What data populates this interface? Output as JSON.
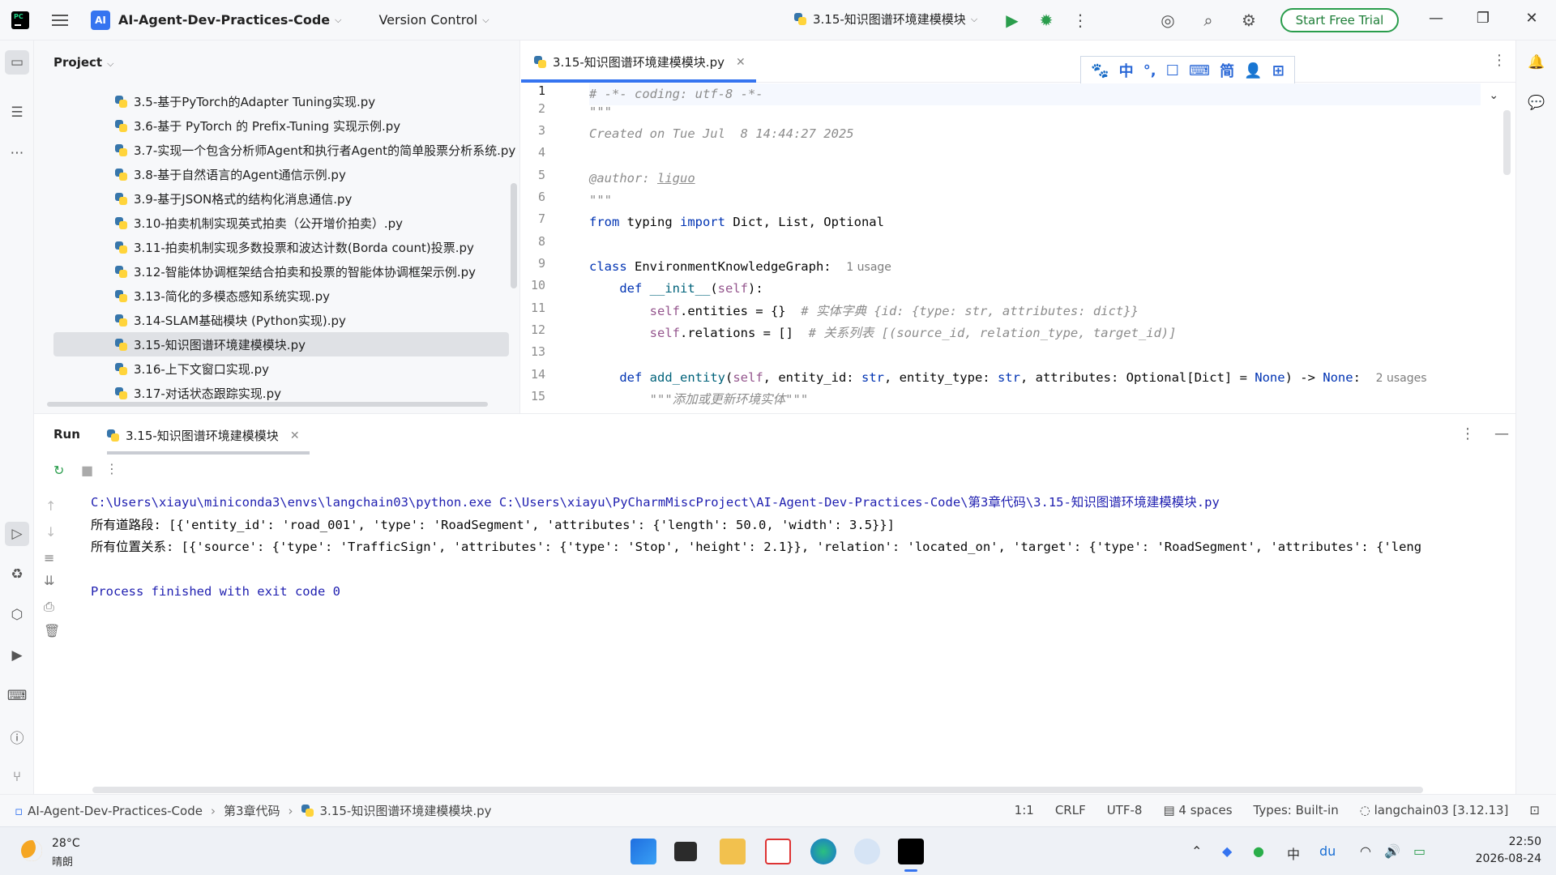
{
  "titlebar": {
    "project_badge": "AI",
    "project_name": "AI-Agent-Dev-Practices-Code",
    "version_control": "Version Control",
    "run_config": "3.15-知识图谱环境建模模块",
    "trial_button": "Start Free Trial"
  },
  "project_panel": {
    "title": "Project",
    "files": [
      "3.5-基于PyTorch的Adapter Tuning实现.py",
      "3.6-基于 PyTorch 的 Prefix-Tuning 实现示例.py",
      "3.7-实现一个包含分析师Agent和执行者Agent的简单股票分析系统.py",
      "3.8-基于自然语言的Agent通信示例.py",
      "3.9-基于JSON格式的结构化消息通信.py",
      "3.10-拍卖机制实现英式拍卖（公开增价拍卖）.py",
      "3.11-拍卖机制实现多数投票和波达计数(Borda count)投票.py",
      "3.12-智能体协调框架结合拍卖和投票的智能体协调框架示例.py",
      "3.13-简化的多模态感知系统实现.py",
      "3.14-SLAM基础模块 (Python实现).py",
      "3.15-知识图谱环境建模模块.py",
      "3.16-上下文窗口实现.py",
      "3.17-对话状态跟踪实现.py"
    ]
  },
  "editor": {
    "tab_label": "3.15-知识图谱环境建模模块.py",
    "inspection_count": "1",
    "ime_buttons": [
      "🐾",
      "中",
      "°,",
      "☐",
      "⌨",
      "简",
      "👤",
      "⊞"
    ],
    "line_numbers": [
      "1",
      "2",
      "3",
      "4",
      "5",
      "6",
      "7",
      "8",
      "9",
      "10",
      "11",
      "12",
      "13",
      "14",
      "15"
    ],
    "lines": {
      "l1": "# -*- coding: utf-8 -*-",
      "l2": "\"\"\"",
      "l3": "Created on Tue Jul  8 14:44:27 2025",
      "l5_a": "@author: ",
      "l5_b": "liguo",
      "l6": "\"\"\"",
      "l7_from": "from",
      "l7_mid": " typing ",
      "l7_import": "import",
      "l7_rest": " Dict, List, Optional",
      "l9_class": "class",
      "l9_name": " EnvironmentKnowledgeGraph:",
      "l9_hint": "1 usage",
      "l10_def": "    def",
      "l10_fn": " __init__",
      "l10_p": "(",
      "l10_self": "self",
      "l10_end": "):",
      "l11_self": "        self",
      "l11_code": ".entities = {}  ",
      "l11_cmt": "# 实体字典 {id: {type: str, attributes: dict}}",
      "l12_self": "        self",
      "l12_code": ".relations = []  ",
      "l12_cmt": "# 关系列表 [(source_id, relation_type, target_id)]",
      "l14_def": "    def",
      "l14_fn": " add_entity",
      "l14_p": "(",
      "l14_self": "self",
      "l14_args1": ", entity_id: ",
      "l14_str1": "str",
      "l14_args2": ", entity_type: ",
      "l14_str2": "str",
      "l14_args3": ", attributes: Optional[Dict] = ",
      "l14_none": "None",
      "l14_arrow": ") -> ",
      "l14_none2": "None",
      "l14_colon": ":",
      "l14_hint": "2 usages",
      "l15": "        \"\"\"添加或更新环境实体\"\"\""
    }
  },
  "run_panel": {
    "title": "Run",
    "tab_label": "3.15-知识图谱环境建模模块",
    "console": [
      "C:\\Users\\xiayu\\miniconda3\\envs\\langchain03\\python.exe C:\\Users\\xiayu\\PyCharmMiscProject\\AI-Agent-Dev-Practices-Code\\第3章代码\\3.15-知识图谱环境建模模块.py",
      "所有道路段: [{'entity_id': 'road_001', 'type': 'RoadSegment', 'attributes': {'length': 50.0, 'width': 3.5}}]",
      "所有位置关系: [{'source': {'type': 'TrafficSign', 'attributes': {'type': 'Stop', 'height': 2.1}}, 'relation': 'located_on', 'target': {'type': 'RoadSegment', 'attributes': {'leng",
      "",
      "Process finished with exit code 0"
    ]
  },
  "statusbar": {
    "crumbs": [
      "AI-Agent-Dev-Practices-Code",
      "第3章代码",
      "3.15-知识图谱环境建模模块.py"
    ],
    "position": "1:1",
    "line_sep": "CRLF",
    "encoding": "UTF-8",
    "indent": "4 spaces",
    "types": "Types: Built-in",
    "interpreter": "langchain03 [3.12.13]"
  },
  "taskbar": {
    "temp": "28°C",
    "condition": "晴朗",
    "time": "22:50",
    "date": "2026-08-24"
  }
}
